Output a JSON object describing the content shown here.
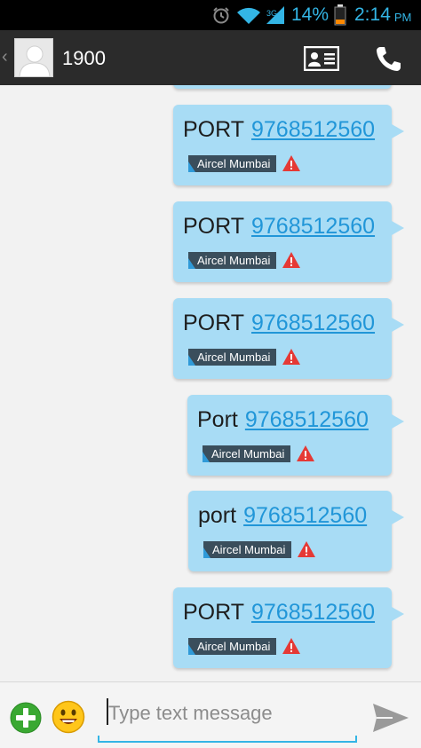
{
  "status_bar": {
    "battery_percent": "14%",
    "time": "2:14",
    "ampm": "PM",
    "icons": [
      "alarm-icon",
      "wifi-icon",
      "signal-icon",
      "battery-icon"
    ]
  },
  "header": {
    "contact_name": "1900",
    "icons": [
      "back-chevron-icon",
      "contact-card-icon",
      "phone-icon"
    ]
  },
  "messages": [
    {
      "text": "PORT",
      "number": "9768512560",
      "sim_label": "Aircel Mumbai",
      "status": "failed"
    },
    {
      "text": "PORT",
      "number": "9768512560",
      "sim_label": "Aircel Mumbai",
      "status": "failed"
    },
    {
      "text": "PORT",
      "number": "9768512560",
      "sim_label": "Aircel Mumbai",
      "status": "failed"
    },
    {
      "text": "Port",
      "number": "9768512560",
      "sim_label": "Aircel Mumbai",
      "status": "failed"
    },
    {
      "text": "port",
      "number": "9768512560",
      "sim_label": "Aircel Mumbai",
      "status": "failed"
    },
    {
      "text": "PORT",
      "number": "9768512560",
      "sim_label": "Aircel Mumbai",
      "status": "failed"
    }
  ],
  "compose": {
    "placeholder": "Type text message",
    "value": "",
    "icons": [
      "attach-plus-icon",
      "emoji-icon",
      "send-icon"
    ]
  },
  "colors": {
    "accent": "#33b5e5",
    "bubble": "#a8dcf5",
    "link": "#2196d8",
    "action_bar": "#2b2b2b",
    "warning": "#e53935",
    "attach_green": "#3aa832"
  }
}
